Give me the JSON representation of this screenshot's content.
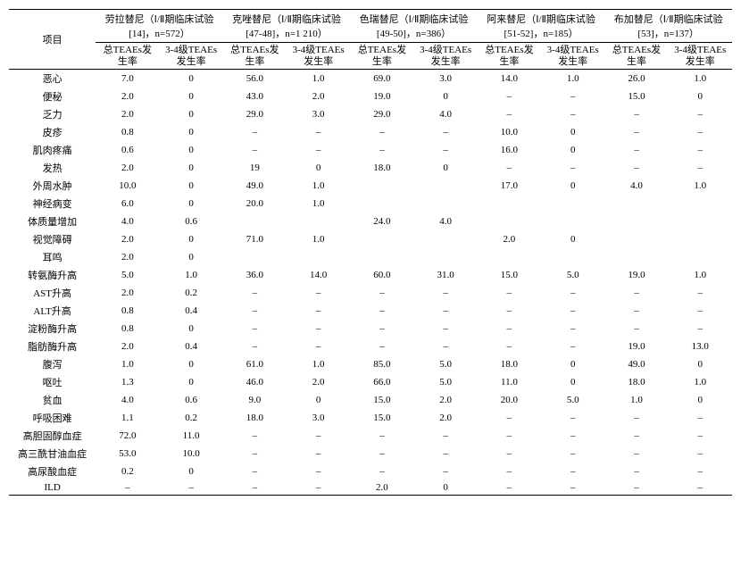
{
  "header": {
    "project": "项目",
    "groups": [
      {
        "title": "劳拉替尼（Ⅰ/Ⅱ期临床试验[14]，n=572）"
      },
      {
        "title": "克唑替尼（Ⅰ/Ⅱ期临床试验[47-48]，n=1 210）"
      },
      {
        "title": "色瑞替尼（Ⅰ/Ⅱ期临床试验[49-50]，n=386）"
      },
      {
        "title": "阿来替尼（Ⅰ/Ⅱ期临床试验[51-52]，n=185）"
      },
      {
        "title": "布加替尼（Ⅰ/Ⅱ期临床试验[53]，n=137）"
      }
    ],
    "sub": {
      "total": "总TEAEs发生率",
      "grade34": "3-4级TEAEs发生率"
    }
  },
  "rows": [
    {
      "label": "恶心",
      "v": [
        "7.0",
        "0",
        "56.0",
        "1.0",
        "69.0",
        "3.0",
        "14.0",
        "1.0",
        "26.0",
        "1.0"
      ]
    },
    {
      "label": "便秘",
      "v": [
        "2.0",
        "0",
        "43.0",
        "2.0",
        "19.0",
        "0",
        "–",
        "–",
        "15.0",
        "0"
      ]
    },
    {
      "label": "乏力",
      "v": [
        "2.0",
        "0",
        "29.0",
        "3.0",
        "29.0",
        "4.0",
        "–",
        "–",
        "–",
        "–"
      ]
    },
    {
      "label": "皮疹",
      "v": [
        "0.8",
        "0",
        "–",
        "–",
        "–",
        "–",
        "10.0",
        "0",
        "–",
        "–"
      ]
    },
    {
      "label": "肌肉疼痛",
      "v": [
        "0.6",
        "0",
        "–",
        "–",
        "–",
        "–",
        "16.0",
        "0",
        "–",
        "–"
      ]
    },
    {
      "label": "发热",
      "v": [
        "2.0",
        "0",
        "19",
        "0",
        "18.0",
        "0",
        "–",
        "–",
        "–",
        "–"
      ]
    },
    {
      "label": "外周水肿",
      "v": [
        "10.0",
        "0",
        "49.0",
        "1.0",
        "",
        "",
        "17.0",
        "0",
        "4.0",
        "1.0"
      ]
    },
    {
      "label": "神经病变",
      "v": [
        "6.0",
        "0",
        "20.0",
        "1.0",
        "",
        "",
        "",
        "",
        "",
        ""
      ]
    },
    {
      "label": "体质量增加",
      "v": [
        "4.0",
        "0.6",
        "",
        "",
        "24.0",
        "4.0",
        "",
        "",
        "",
        ""
      ]
    },
    {
      "label": "视觉障碍",
      "v": [
        "2.0",
        "0",
        "71.0",
        "1.0",
        "",
        "",
        "2.0",
        "0",
        "",
        ""
      ]
    },
    {
      "label": "耳鸣",
      "v": [
        "2.0",
        "0",
        "",
        "",
        "",
        "",
        "",
        "",
        "",
        ""
      ]
    },
    {
      "label": "转氨酶升高",
      "v": [
        "5.0",
        "1.0",
        "36.0",
        "14.0",
        "60.0",
        "31.0",
        "15.0",
        "5.0",
        "19.0",
        "1.0"
      ]
    },
    {
      "label": "AST升高",
      "v": [
        "2.0",
        "0.2",
        "–",
        "–",
        "–",
        "–",
        "–",
        "–",
        "–",
        "–"
      ]
    },
    {
      "label": "ALT升高",
      "v": [
        "0.8",
        "0.4",
        "–",
        "–",
        "–",
        "–",
        "–",
        "–",
        "–",
        "–"
      ]
    },
    {
      "label": "淀粉酶升高",
      "v": [
        "0.8",
        "0",
        "–",
        "–",
        "–",
        "–",
        "–",
        "–",
        "–",
        "–"
      ]
    },
    {
      "label": "脂肪酶升高",
      "v": [
        "2.0",
        "0.4",
        "–",
        "–",
        "–",
        "–",
        "–",
        "–",
        "19.0",
        "13.0"
      ]
    },
    {
      "label": "腹泻",
      "v": [
        "1.0",
        "0",
        "61.0",
        "1.0",
        "85.0",
        "5.0",
        "18.0",
        "0",
        "49.0",
        "0"
      ]
    },
    {
      "label": "呕吐",
      "v": [
        "1.3",
        "0",
        "46.0",
        "2.0",
        "66.0",
        "5.0",
        "11.0",
        "0",
        "18.0",
        "1.0"
      ]
    },
    {
      "label": "贫血",
      "v": [
        "4.0",
        "0.6",
        "9.0",
        "0",
        "15.0",
        "2.0",
        "20.0",
        "5.0",
        "1.0",
        "0"
      ]
    },
    {
      "label": "呼吸困难",
      "v": [
        "1.1",
        "0.2",
        "18.0",
        "3.0",
        "15.0",
        "2.0",
        "–",
        "–",
        "–",
        "–"
      ]
    },
    {
      "label": "高胆固醇血症",
      "v": [
        "72.0",
        "11.0",
        "–",
        "–",
        "–",
        "–",
        "–",
        "–",
        "–",
        "–"
      ]
    },
    {
      "label": "高三酰甘油血症",
      "v": [
        "53.0",
        "10.0",
        "–",
        "–",
        "–",
        "–",
        "–",
        "–",
        "–",
        "–"
      ]
    },
    {
      "label": "高尿酸血症",
      "v": [
        "0.2",
        "0",
        "–",
        "–",
        "–",
        "–",
        "–",
        "–",
        "–",
        "–"
      ]
    },
    {
      "label": "ILD",
      "v": [
        "–",
        "–",
        "–",
        "–",
        "2.0",
        "0",
        "–",
        "–",
        "–",
        "–"
      ]
    }
  ]
}
